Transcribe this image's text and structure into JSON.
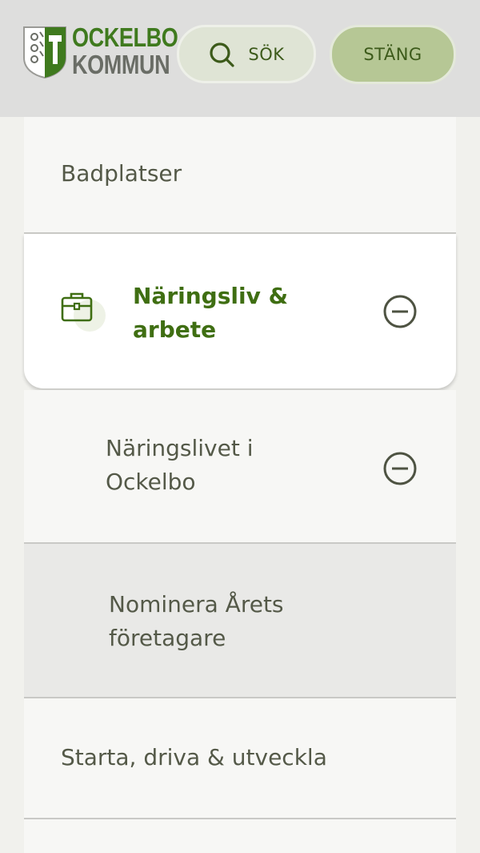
{
  "header": {
    "logo": {
      "line1": "OCKELBO",
      "line2": "KOMMUN"
    },
    "search_button": {
      "label": "SÖK",
      "icon": "search-icon"
    },
    "close_button": {
      "label": "STÄNG"
    }
  },
  "menu": {
    "items": [
      {
        "label": "Badplatser"
      },
      {
        "label": "Näringsliv & arbete",
        "icon": "briefcase-icon",
        "toggle_icon": "minus-circle-icon"
      },
      {
        "label": "Näringslivet i Ockelbo",
        "toggle_icon": "minus-circle-icon"
      },
      {
        "label": "Nominera Årets företagare"
      },
      {
        "label": "Starta, driva & utveckla"
      }
    ]
  },
  "colors": {
    "header_bg": "#dededd",
    "accent_green": "#3f6e12",
    "close_button_bg": "#b6c795",
    "search_button_bg": "#dfe4d5",
    "text": "#545948"
  }
}
